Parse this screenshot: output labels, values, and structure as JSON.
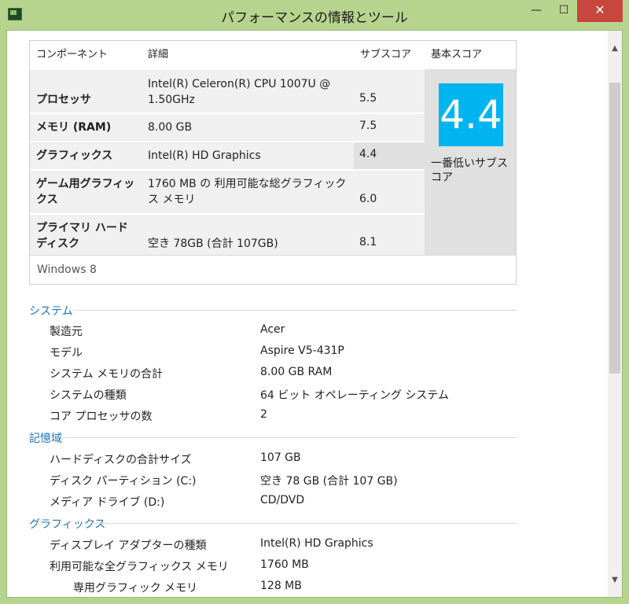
{
  "window": {
    "title": "パフォーマンスの情報とツール",
    "minimize_glyph": "—",
    "maximize_glyph": "☐",
    "close_glyph": "✕",
    "accent_color": "#b7d48e",
    "close_color": "#c7463d"
  },
  "score_table": {
    "headers": {
      "component": "コンポーネント",
      "detail": "詳細",
      "subscore": "サブスコア",
      "basescore": "基本スコア"
    },
    "rows": [
      {
        "component": "プロセッサ",
        "detail": "Intel(R) Celeron(R) CPU 1007U @ 1.50GHz",
        "subscore": "5.5"
      },
      {
        "component": "メモリ (RAM)",
        "detail": "8.00 GB",
        "subscore": "7.5"
      },
      {
        "component": "グラフィックス",
        "detail": "Intel(R) HD Graphics",
        "subscore": "4.4"
      },
      {
        "component": "ゲーム用グラフィックス",
        "detail": "1760 MB の 利用可能な総グラフィックス メモリ",
        "subscore": "6.0"
      },
      {
        "component": "プライマリ ハード ディスク",
        "detail": "空き 78GB (合計 107GB)",
        "subscore": "8.1"
      }
    ],
    "base_score": "4.4",
    "base_score_caption": "一番低いサブスコア",
    "tile_color": "#00b4f0",
    "os": "Windows 8"
  },
  "sections": {
    "system": {
      "title": "システム",
      "items": [
        {
          "label": "製造元",
          "value": "Acer"
        },
        {
          "label": "モデル",
          "value": "Aspire V5-431P"
        },
        {
          "label": "システム メモリの合計",
          "value": "8.00 GB RAM"
        },
        {
          "label": "システムの種類",
          "value": "64 ビット オペレーティング システム"
        },
        {
          "label": "コア プロセッサの数",
          "value": "2"
        }
      ]
    },
    "storage": {
      "title": "記憶域",
      "items": [
        {
          "label": "ハードディスクの合計サイズ",
          "value": "107 GB"
        },
        {
          "label": "ディスク パーティション (C:)",
          "value": "空き 78 GB (合計 107 GB)"
        },
        {
          "label": "メディア ドライブ (D:)",
          "value": "CD/DVD"
        }
      ]
    },
    "graphics": {
      "title": "グラフィックス",
      "items": [
        {
          "label": "ディスプレイ アダプターの種類",
          "value": "Intel(R) HD Graphics"
        },
        {
          "label": "利用可能な全グラフィックス メモリ",
          "value": "1760 MB"
        },
        {
          "label": "専用グラフィック メモリ",
          "value": "128 MB"
        }
      ]
    }
  },
  "scrollbar": {
    "up_glyph": "▲",
    "down_glyph": "▼"
  }
}
